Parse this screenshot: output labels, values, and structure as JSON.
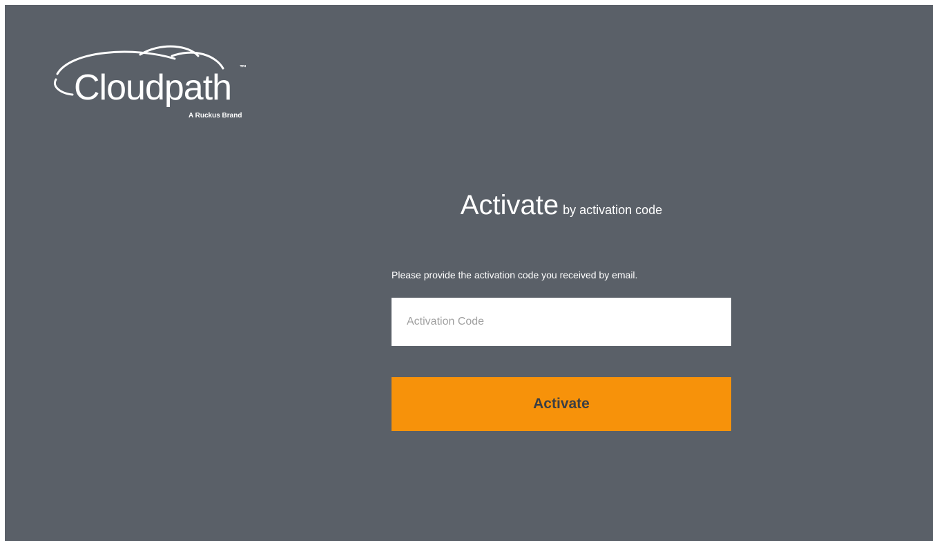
{
  "brand": {
    "name": "Cloudpath",
    "trademark": "™",
    "tagline": "A Ruckus Brand"
  },
  "heading": {
    "title": "Activate",
    "subtitle": "by activation code"
  },
  "form": {
    "instructions": "Please provide the activation code you received by email.",
    "code_placeholder": "Activation Code",
    "code_value": "",
    "submit_label": "Activate"
  },
  "colors": {
    "background": "#5a6068",
    "accent": "#f7920a",
    "button_text": "#3c3f44"
  }
}
